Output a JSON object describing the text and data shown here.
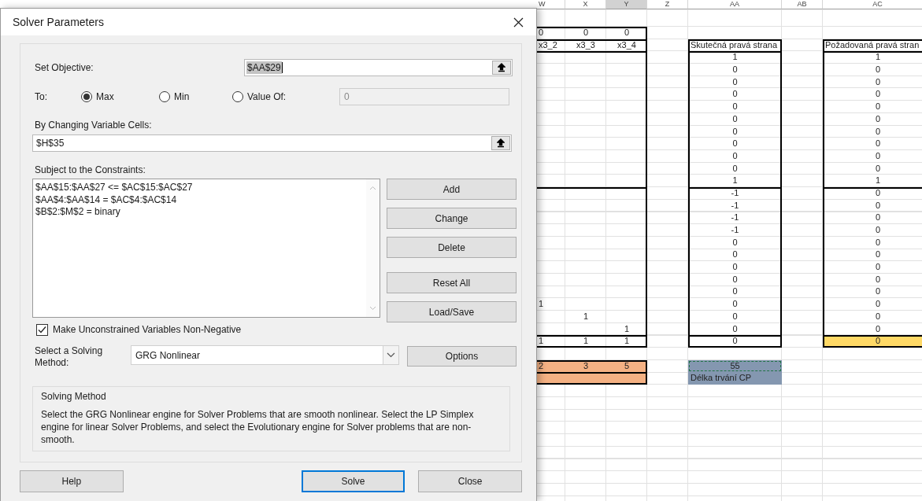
{
  "dialog": {
    "title": "Solver Parameters",
    "objective": {
      "label": "Set Objective:",
      "value": "$AA$29",
      "highlighted": true
    },
    "to": {
      "label": "To:",
      "options": [
        {
          "label": "Max",
          "selected": true
        },
        {
          "label": "Min",
          "selected": false
        },
        {
          "label": "Value Of:",
          "selected": false
        }
      ],
      "value_field": {
        "value": "0",
        "disabled": true
      }
    },
    "changing_cells": {
      "label": "By Changing Variable Cells:",
      "value": "$H$35"
    },
    "constraints": {
      "label": "Subject to the Constraints:",
      "items": [
        "$AA$15:$AA$27 <= $AC$15:$AC$27",
        "$AA$4:$AA$14 = $AC$4:$AC$14",
        "$B$2:$M$2 = binary"
      ]
    },
    "side_buttons": [
      {
        "label": "Add"
      },
      {
        "label": "Change"
      },
      {
        "label": "Delete"
      },
      {
        "label": "Reset All"
      },
      {
        "label": "Load/Save"
      }
    ],
    "non_negative": {
      "label": "Make Unconstrained Variables Non-Negative",
      "checked": true
    },
    "method": {
      "label": "Select a Solving Method:",
      "value": "GRG Nonlinear"
    },
    "options_button": {
      "label": "Options"
    },
    "description": {
      "title": "Solving Method",
      "text": "Select the GRG Nonlinear engine for Solver Problems that are smooth nonlinear. Select the LP Simplex engine for linear Solver Problems, and select the Evolutionary engine for Solver problems that are non-smooth."
    },
    "footer_buttons": [
      {
        "label": "Help",
        "default": false
      },
      {
        "label": "Solve",
        "default": true
      },
      {
        "label": "Close",
        "default": false
      }
    ]
  },
  "sheet": {
    "columns": [
      {
        "label": "W",
        "selected": false
      },
      {
        "label": "X",
        "selected": false
      },
      {
        "label": "Y",
        "selected": true
      },
      {
        "label": "Z",
        "selected": false
      },
      {
        "label": "AA",
        "selected": false
      },
      {
        "label": "AB",
        "selected": false
      },
      {
        "label": "AC",
        "selected": false
      }
    ],
    "rows": [
      {},
      {
        "W": {
          "text": "0",
          "top": true
        },
        "X": {
          "text": "0",
          "top": true
        },
        "Y": {
          "text": "0",
          "top": true,
          "right": true
        }
      },
      {
        "W": {
          "text": "x3_2",
          "top": true
        },
        "X": {
          "text": "x3_3",
          "top": true
        },
        "Y": {
          "text": "x3_4",
          "top": true,
          "right": true
        },
        "AA": {
          "text": "Skutečná pravá strana",
          "top": true,
          "left": true,
          "right": true,
          "left_aligned": true
        },
        "AC": {
          "text": "Požadovaná pravá stran",
          "top": true,
          "left": true,
          "left_aligned": true
        }
      },
      {
        "W": {
          "top": true
        },
        "X": {
          "top": true
        },
        "Y": {
          "top": true,
          "right": true
        },
        "AA": {
          "text": "1",
          "top": true,
          "left": true,
          "right": true
        },
        "AC": {
          "text": "1",
          "top": true,
          "left": true
        }
      },
      {
        "Y": {
          "right": true
        },
        "AA": {
          "text": "0",
          "left": true,
          "right": true
        },
        "AC": {
          "text": "0",
          "left": true
        }
      },
      {
        "Y": {
          "right": true
        },
        "AA": {
          "text": "0",
          "left": true,
          "right": true
        },
        "AC": {
          "text": "0",
          "left": true
        }
      },
      {
        "Y": {
          "right": true
        },
        "AA": {
          "text": "0",
          "left": true,
          "right": true
        },
        "AC": {
          "text": "0",
          "left": true
        }
      },
      {
        "Y": {
          "right": true
        },
        "AA": {
          "text": "0",
          "left": true,
          "right": true
        },
        "AC": {
          "text": "0",
          "left": true
        }
      },
      {
        "Y": {
          "right": true
        },
        "AA": {
          "text": "0",
          "left": true,
          "right": true
        },
        "AC": {
          "text": "0",
          "left": true
        }
      },
      {
        "Y": {
          "right": true
        },
        "AA": {
          "text": "0",
          "left": true,
          "right": true
        },
        "AC": {
          "text": "0",
          "left": true
        }
      },
      {
        "Y": {
          "right": true
        },
        "AA": {
          "text": "0",
          "left": true,
          "right": true
        },
        "AC": {
          "text": "0",
          "left": true
        }
      },
      {
        "Y": {
          "right": true
        },
        "AA": {
          "text": "0",
          "left": true,
          "right": true
        },
        "AC": {
          "text": "0",
          "left": true
        }
      },
      {
        "Y": {
          "right": true
        },
        "AA": {
          "text": "0",
          "left": true,
          "right": true
        },
        "AC": {
          "text": "0",
          "left": true
        }
      },
      {
        "Y": {
          "right": true
        },
        "AA": {
          "text": "1",
          "left": true,
          "right": true
        },
        "AC": {
          "text": "1",
          "left": true
        }
      },
      {
        "W": {
          "top": true
        },
        "X": {
          "top": true
        },
        "Y": {
          "top": true,
          "right": true
        },
        "AA": {
          "text": "-1",
          "top": true,
          "left": true,
          "right": true
        },
        "AC": {
          "text": "0",
          "top": true,
          "left": true
        }
      },
      {
        "Y": {
          "right": true
        },
        "AA": {
          "text": "-1",
          "left": true,
          "right": true
        },
        "AC": {
          "text": "0",
          "left": true
        }
      },
      {
        "Y": {
          "right": true
        },
        "AA": {
          "text": "-1",
          "left": true,
          "right": true
        },
        "AC": {
          "text": "0",
          "left": true
        }
      },
      {
        "Y": {
          "right": true
        },
        "AA": {
          "text": "-1",
          "left": true,
          "right": true
        },
        "AC": {
          "text": "0",
          "left": true
        }
      },
      {
        "Y": {
          "right": true
        },
        "AA": {
          "text": "0",
          "left": true,
          "right": true
        },
        "AC": {
          "text": "0",
          "left": true
        }
      },
      {
        "Y": {
          "right": true
        },
        "AA": {
          "text": "0",
          "left": true,
          "right": true
        },
        "AC": {
          "text": "0",
          "left": true
        }
      },
      {
        "Y": {
          "right": true
        },
        "AA": {
          "text": "0",
          "left": true,
          "right": true
        },
        "AC": {
          "text": "0",
          "left": true
        }
      },
      {
        "Y": {
          "right": true
        },
        "AA": {
          "text": "0",
          "left": true,
          "right": true
        },
        "AC": {
          "text": "0",
          "left": true
        }
      },
      {
        "Y": {
          "right": true
        },
        "AA": {
          "text": "0",
          "left": true,
          "right": true
        },
        "AC": {
          "text": "0",
          "left": true
        }
      },
      {
        "W": {
          "text": "1"
        },
        "Y": {
          "right": true
        },
        "AA": {
          "text": "0",
          "left": true,
          "right": true
        },
        "AC": {
          "text": "0",
          "left": true
        }
      },
      {
        "X": {
          "text": "1"
        },
        "Y": {
          "right": true
        },
        "AA": {
          "text": "0",
          "left": true,
          "right": true
        },
        "AC": {
          "text": "0",
          "left": true
        }
      },
      {
        "Y": {
          "text": "1",
          "right": true
        },
        "AA": {
          "text": "0",
          "left": true,
          "right": true
        },
        "AC": {
          "text": "0",
          "left": true
        }
      },
      {
        "W": {
          "text": "1",
          "top": true,
          "bottom": true
        },
        "X": {
          "text": "1",
          "top": true,
          "bottom": true
        },
        "Y": {
          "text": "1",
          "top": true,
          "bottom": true,
          "right": true
        },
        "AA": {
          "text": "0",
          "top": true,
          "bottom": true,
          "left": true,
          "right": true
        },
        "AC": {
          "text": "0",
          "top": true,
          "bottom": true,
          "left": true,
          "color": "#ffd966"
        }
      },
      {},
      {
        "W": {
          "text": "2",
          "top": true,
          "color": "#f4b183"
        },
        "X": {
          "text": "3",
          "top": true,
          "color": "#f4b183"
        },
        "Y": {
          "text": "5",
          "top": true,
          "right": true,
          "color": "#f4b183"
        },
        "AA": {
          "text": "55",
          "color": "#8497b0",
          "copied": true
        }
      },
      {
        "W": {
          "top": true,
          "bottom": true,
          "color": "#f4b183"
        },
        "X": {
          "top": true,
          "bottom": true,
          "color": "#f4b183"
        },
        "Y": {
          "top": true,
          "bottom": true,
          "right": true,
          "color": "#f4b183"
        },
        "AA": {
          "text": "Délka trvání CP",
          "color": "#8497b0",
          "left_aligned": true
        }
      },
      {},
      {},
      {},
      {},
      {},
      {},
      {},
      {},
      {}
    ]
  }
}
